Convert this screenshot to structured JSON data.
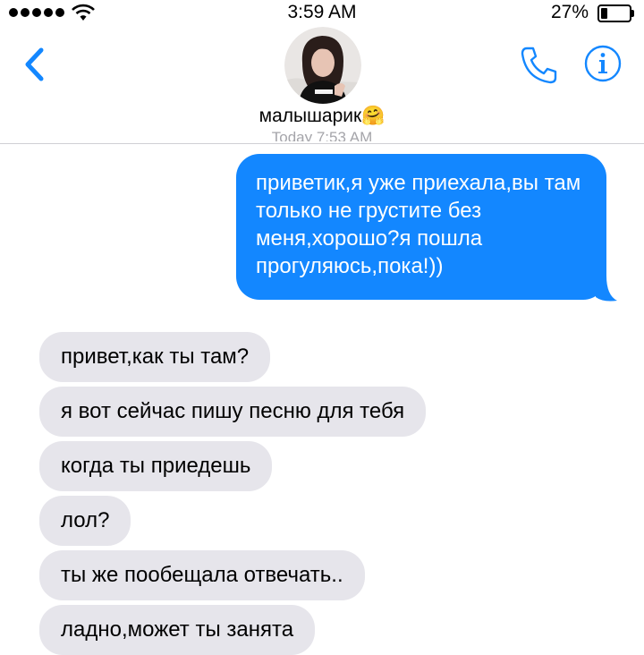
{
  "status_bar": {
    "time": "3:59 AM",
    "battery_percent": "27%",
    "battery_level": 0.27,
    "signal_bars": 5,
    "wifi_icon": "wifi-icon"
  },
  "header": {
    "contact_name": "малышарик🤗",
    "back_icon": "chevron-left-icon",
    "call_icon": "phone-icon",
    "info_icon": "info-icon",
    "timestamp_partial": "Today 7:53 AM",
    "accent_color": "#1387ff"
  },
  "messages": [
    {
      "from": "me",
      "text": "приветик,я уже приехала,вы там только не грустите без меня,хорошо?я пошла прогуляюсь,пока!))"
    },
    {
      "from": "them",
      "text": "привет,как ты там?"
    },
    {
      "from": "them",
      "text": "я вот сейчас пишу песню для тебя"
    },
    {
      "from": "them",
      "text": "когда ты приедешь"
    },
    {
      "from": "them",
      "text": "лол?"
    },
    {
      "from": "them",
      "text": "ты же пообещала отвечать.."
    },
    {
      "from": "them",
      "text": "ладно,может ты занята"
    }
  ]
}
